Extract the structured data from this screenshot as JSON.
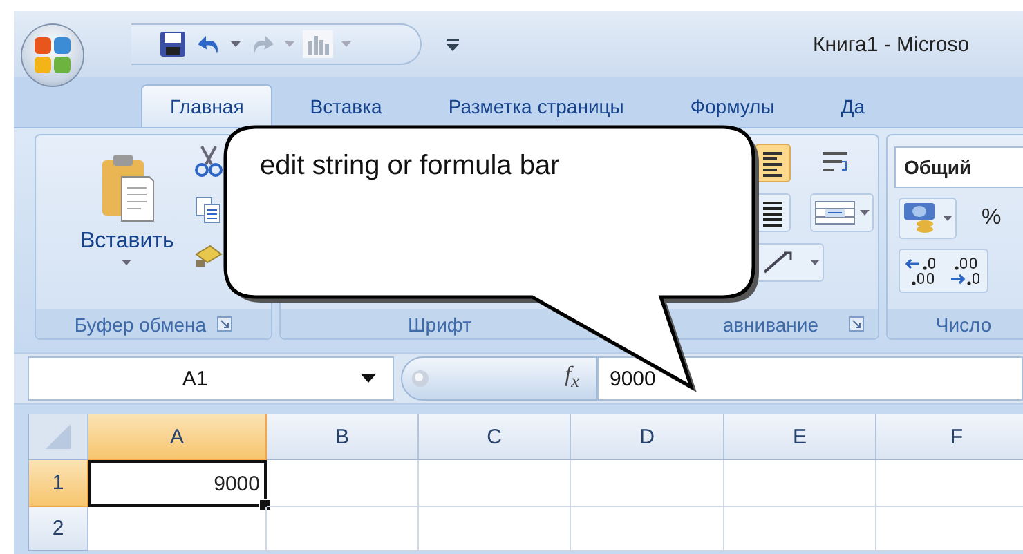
{
  "title_bar": {
    "title": "Книга1 - Microso"
  },
  "tabs": [
    {
      "label": "Главная",
      "selected": true
    },
    {
      "label": "Вставка",
      "selected": false
    },
    {
      "label": "Разметка страницы",
      "selected": false
    },
    {
      "label": "Формулы",
      "selected": false
    },
    {
      "label": "Да",
      "selected": false
    }
  ],
  "ribbon": {
    "groups": [
      {
        "label": "Буфер обмена"
      },
      {
        "label": "Шрифт"
      },
      {
        "label": "авнивание"
      },
      {
        "label": "Число"
      }
    ],
    "paste_label": "Вставить",
    "number_format": "Общий",
    "percent": "%"
  },
  "formula_bar": {
    "name_box": "A1",
    "function_label": "f$_{x}$",
    "value": "9000"
  },
  "sheet": {
    "columns": [
      {
        "label": "A",
        "selected": true
      },
      {
        "label": "B",
        "selected": false
      },
      {
        "label": "C",
        "selected": false
      },
      {
        "label": "D",
        "selected": false
      },
      {
        "label": "E",
        "selected": false
      },
      {
        "label": "F",
        "selected": false
      }
    ],
    "rows": [
      {
        "header": "1",
        "selected": true,
        "cells": [
          {
            "value": "9000",
            "selected": true
          }
        ]
      },
      {
        "header": "2",
        "selected": false,
        "cells": []
      }
    ]
  },
  "callout": {
    "text": "edit string or formula bar"
  }
}
